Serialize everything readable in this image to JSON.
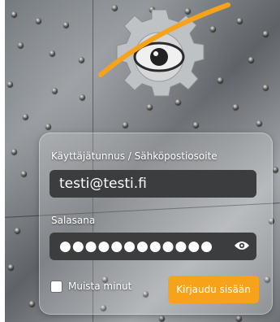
{
  "login_form": {
    "username_label": "Käyttäjätunnus / Sähköpostiosoite",
    "username_value": "testi@testi.fi",
    "password_label": "Salasana",
    "password_masked": "●●●●●●●●●●●●",
    "show_password_icon": "eye-icon",
    "remember_label": "Muista minut",
    "remember_checked": false,
    "submit_label": "Kirjaudu sisään"
  },
  "colors": {
    "accent": "#f6a21b",
    "input_bg": "#3c3d3f",
    "text": "#ffffff"
  }
}
